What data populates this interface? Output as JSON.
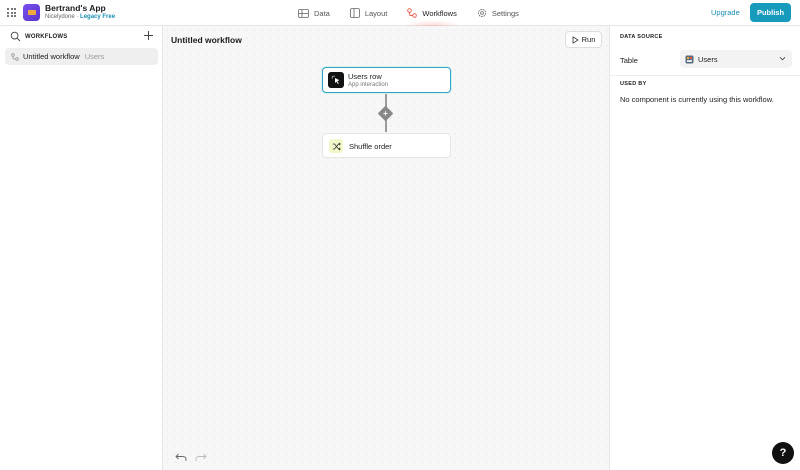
{
  "app": {
    "name": "Bertrand's App",
    "owner": "Nicelydone",
    "separator": "·",
    "plan": "Legacy Free"
  },
  "nav": [
    {
      "label": "Data",
      "icon": "table-icon"
    },
    {
      "label": "Layout",
      "icon": "layout-icon"
    },
    {
      "label": "Workflows",
      "icon": "workflow-icon",
      "active": true
    },
    {
      "label": "Settings",
      "icon": "gear-icon"
    }
  ],
  "header": {
    "upgrade_label": "Upgrade",
    "publish_label": "Publish"
  },
  "sidebar": {
    "title": "WORKFLOWS",
    "items": [
      {
        "label": "Untitled workflow",
        "secondary": "Users"
      }
    ]
  },
  "canvas": {
    "title": "Untitled workflow",
    "run_label": "Run",
    "trigger": {
      "title": "Users row",
      "subtitle": "App interaction"
    },
    "action": {
      "title": "Shuffle order"
    },
    "add_symbol": "+"
  },
  "panel": {
    "data_source_label": "DATA SOURCE",
    "table_label": "Table",
    "table_value": "Users",
    "used_by_label": "USED BY",
    "used_by_text": "No component is currently using this workflow."
  },
  "help_label": "?",
  "colors": {
    "accent": "#179bbd",
    "link": "#1a8fb3",
    "node_border": "#2fa6c2",
    "active_tab_glow": "#f4645a"
  }
}
